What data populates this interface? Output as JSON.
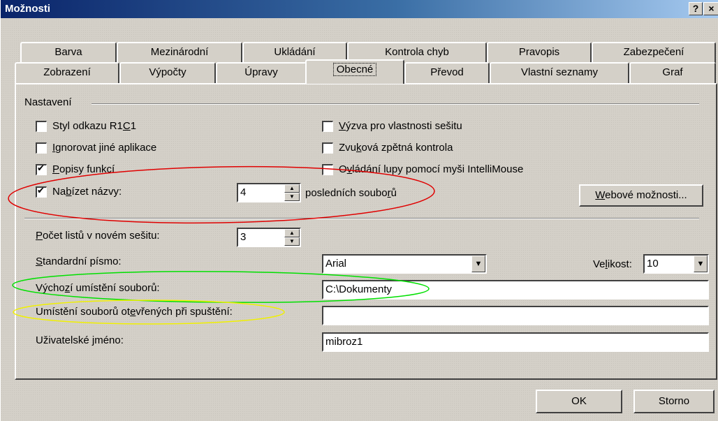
{
  "window": {
    "title": "Možnosti",
    "help_label": "?",
    "close_label": "×"
  },
  "tabs": {
    "row1": [
      "Barva",
      "Mezinárodní",
      "Ukládání",
      "Kontrola chyb",
      "Pravopis",
      "Zabezpečení"
    ],
    "row2": [
      "Zobrazení",
      "Výpočty",
      "Úpravy",
      "Obecné",
      "Převod",
      "Vlastní seznamy",
      "Graf"
    ],
    "active": "Obecné"
  },
  "settings": {
    "group_title": "Nastavení",
    "checkboxes": [
      {
        "pre": "Styl odkazu R1",
        "u": "C",
        "post": "1",
        "checked": false
      },
      {
        "pre": "",
        "u": "I",
        "post": "gnorovat jiné aplikace",
        "checked": false
      },
      {
        "pre": "",
        "u": "P",
        "post": "opisy funkcí",
        "checked": true
      },
      {
        "pre": "Na",
        "u": "b",
        "post": "ízet názvy:",
        "checked": true
      },
      {
        "pre": "",
        "u": "V",
        "post": "ýzva pro vlastnosti sešitu",
        "checked": false
      },
      {
        "pre": "Zvu",
        "u": "k",
        "post": "ová zpětná kontrola",
        "checked": false
      },
      {
        "pre": "O",
        "u": "v",
        "post": "ládání lupy pomocí myši IntelliMouse",
        "checked": false
      }
    ],
    "recent_files_count": "4",
    "recent_files_suffix_pre": "posledních soubo",
    "recent_files_suffix_u": "r",
    "recent_files_suffix_post": "ů",
    "web_options_u": "W",
    "web_options_rest": "ebové možnosti..."
  },
  "general": {
    "sheets_label_u": "P",
    "sheets_label_rest": "očet listů v novém sešitu:",
    "sheets_value": "3",
    "font_label_u": "S",
    "font_label_rest": "tandardní písmo:",
    "font_value": "Arial",
    "size_label_pre": "Ve",
    "size_label_u": "l",
    "size_label_post": "ikost:",
    "size_value": "10",
    "default_location_pre": "Výcho",
    "default_location_u": "z",
    "default_location_post": "í umístění souborů:",
    "default_location_value": "C:\\Dokumenty",
    "startup_location_pre": "Umístění souborů ot",
    "startup_location_u": "e",
    "startup_location_post": "vřených při spuštění:",
    "startup_location_value": "",
    "username_pre": "Uživatelské ",
    "username_u": "j",
    "username_post": "méno:",
    "username_value": "mibroz1"
  },
  "buttons": {
    "ok": "OK",
    "cancel": "Storno"
  },
  "annotation_colors": {
    "red": "#e00000",
    "green": "#00e000",
    "yellow": "#f0f000"
  }
}
